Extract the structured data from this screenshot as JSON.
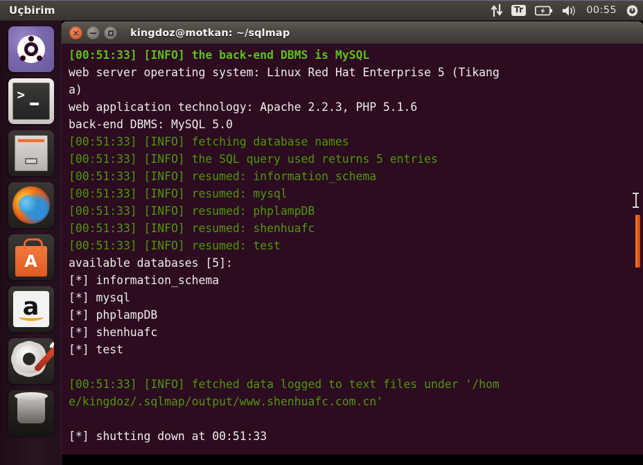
{
  "panel": {
    "app_title": "Uçbirim",
    "clock": "00:55",
    "tray": {
      "network_icon": "network-updown-icon",
      "keyboard_layout": "Tr",
      "battery_icon": "battery-charging-icon",
      "volume_icon": "volume-icon",
      "session_icon": "power-gear-icon"
    }
  },
  "launcher": {
    "items": [
      {
        "name": "ubuntu-dash",
        "label": "Dash home",
        "running": false,
        "focused": false
      },
      {
        "name": "terminal",
        "label": "Uçbirim",
        "running": true,
        "focused": true
      },
      {
        "name": "files",
        "label": "Files",
        "running": false,
        "focused": false
      },
      {
        "name": "firefox",
        "label": "Firefox Web Browser",
        "running": false,
        "focused": false
      },
      {
        "name": "software-center",
        "label": "Ubuntu Software Center",
        "running": false,
        "focused": false
      },
      {
        "name": "amazon",
        "label": "Amazon",
        "running": false,
        "focused": false
      },
      {
        "name": "system-settings",
        "label": "System Settings",
        "running": false,
        "focused": false
      },
      {
        "name": "trash",
        "label": "Trash",
        "running": false,
        "focused": false
      }
    ]
  },
  "window": {
    "title": "kingdoz@motkan: ~/sqlmap",
    "buttons": {
      "close": "×",
      "minimize": "−",
      "maximize": "□"
    }
  },
  "terminal": {
    "background_color": "#2d0b21",
    "colors": {
      "green": "#4e9a06",
      "green_bold": "#5bc116",
      "foreground": "#eeeeec",
      "scrollbar": "#e25816"
    },
    "lines": [
      {
        "segments": [
          {
            "text": "[00:51:33] [INFO] the back-end DBMS is MySQL",
            "style": "green-bold"
          }
        ]
      },
      {
        "segments": [
          {
            "text": "web server operating system: Linux Red Hat Enterprise 5 (Tikang",
            "style": "white"
          }
        ]
      },
      {
        "segments": [
          {
            "text": "a)",
            "style": "white"
          }
        ]
      },
      {
        "segments": [
          {
            "text": "web application technology: Apache 2.2.3, PHP 5.1.6",
            "style": "white"
          }
        ]
      },
      {
        "segments": [
          {
            "text": "back-end DBMS: MySQL 5.0",
            "style": "white"
          }
        ]
      },
      {
        "segments": [
          {
            "text": "[00:51:33] [INFO] fetching database names",
            "style": "green"
          }
        ]
      },
      {
        "segments": [
          {
            "text": "[00:51:33] [INFO] the SQL query used returns 5 entries",
            "style": "green"
          }
        ]
      },
      {
        "segments": [
          {
            "text": "[00:51:33] [INFO] resumed: information_schema",
            "style": "green"
          }
        ]
      },
      {
        "segments": [
          {
            "text": "[00:51:33] [INFO] resumed: mysql",
            "style": "green"
          }
        ]
      },
      {
        "segments": [
          {
            "text": "[00:51:33] [INFO] resumed: phplampDB",
            "style": "green"
          }
        ]
      },
      {
        "segments": [
          {
            "text": "[00:51:33] [INFO] resumed: shenhuafc",
            "style": "green"
          }
        ]
      },
      {
        "segments": [
          {
            "text": "[00:51:33] [INFO] resumed: test",
            "style": "green"
          }
        ]
      },
      {
        "segments": [
          {
            "text": "available databases [5]:",
            "style": "white"
          }
        ]
      },
      {
        "segments": [
          {
            "text": "[*] information_schema",
            "style": "white"
          }
        ]
      },
      {
        "segments": [
          {
            "text": "[*] mysql",
            "style": "white"
          }
        ]
      },
      {
        "segments": [
          {
            "text": "[*] phplampDB",
            "style": "white"
          }
        ]
      },
      {
        "segments": [
          {
            "text": "[*] shenhuafc",
            "style": "white"
          }
        ]
      },
      {
        "segments": [
          {
            "text": "[*] test",
            "style": "white"
          }
        ]
      },
      {
        "segments": [
          {
            "text": "",
            "style": "white"
          }
        ]
      },
      {
        "segments": [
          {
            "text": "[00:51:33] [INFO] fetched data logged to text files under '/hom",
            "style": "green"
          }
        ]
      },
      {
        "segments": [
          {
            "text": "e/kingdoz/.sqlmap/output/www.shenhuafc.com.cn'",
            "style": "green"
          }
        ]
      },
      {
        "segments": [
          {
            "text": "",
            "style": "white"
          }
        ]
      },
      {
        "segments": [
          {
            "text": "[*] shutting down at 00:51:33",
            "style": "white"
          }
        ]
      }
    ]
  }
}
